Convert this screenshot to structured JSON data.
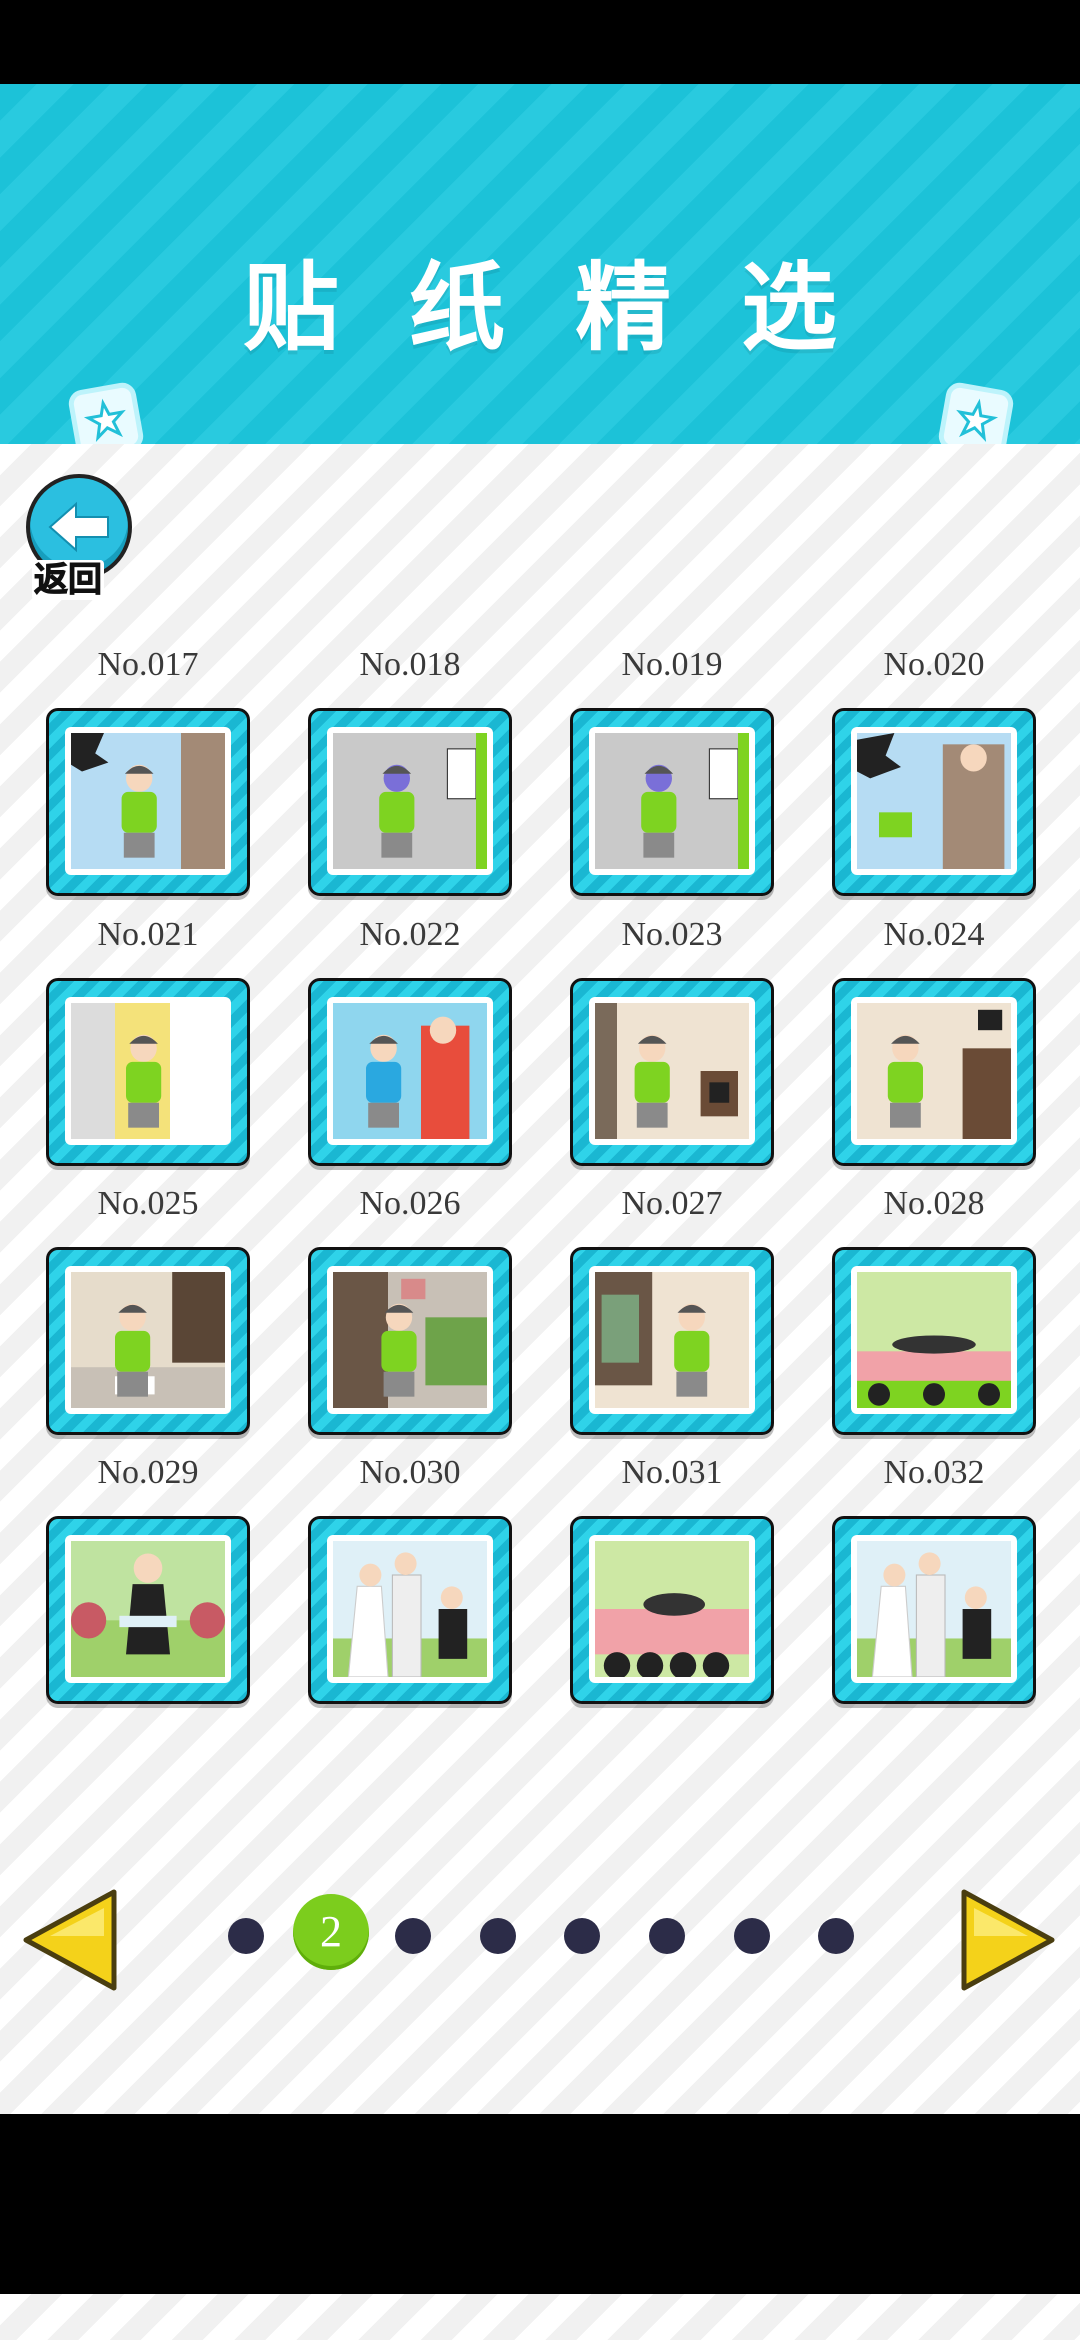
{
  "header": {
    "title": "贴纸精选"
  },
  "back": {
    "label": "返回"
  },
  "stickers": [
    {
      "number": "No.017",
      "scene": "wall-hole-boy",
      "bg": "#b6dcf3"
    },
    {
      "number": "No.018",
      "scene": "boy-purple-face",
      "bg": "#c9c9c9"
    },
    {
      "number": "No.019",
      "scene": "boy-purple-face",
      "bg": "#c9c9c9"
    },
    {
      "number": "No.020",
      "scene": "wall-hole-elder",
      "bg": "#b6dcf3"
    },
    {
      "number": "No.021",
      "scene": "door-visitor",
      "bg": "#f4e27a"
    },
    {
      "number": "No.022",
      "scene": "family-window",
      "bg": "#8fd6ee"
    },
    {
      "number": "No.023",
      "scene": "phone-call",
      "bg": "#efe3d2"
    },
    {
      "number": "No.024",
      "scene": "phone-kneel",
      "bg": "#efe3d2"
    },
    {
      "number": "No.025",
      "scene": "reading-floor",
      "bg": "#e6dccb"
    },
    {
      "number": "No.026",
      "scene": "cabinet",
      "bg": "#c8c0b6"
    },
    {
      "number": "No.027",
      "scene": "phone-music",
      "bg": "#efe3d2"
    },
    {
      "number": "No.028",
      "scene": "wedding-lying",
      "bg": "#cde8a4"
    },
    {
      "number": "No.029",
      "scene": "wedding-boy",
      "bg": "#bfe3a0"
    },
    {
      "number": "No.030",
      "scene": "wedding-couple",
      "bg": "#dff0f7"
    },
    {
      "number": "No.031",
      "scene": "wedding-carpet",
      "bg": "#cde8a4"
    },
    {
      "number": "No.032",
      "scene": "wedding-couple",
      "bg": "#dff0f7"
    }
  ],
  "pager": {
    "current": "2",
    "total": 8
  },
  "colors": {
    "header": "#1cc2d8",
    "active_dot": "#7ccd1d",
    "dot": "#2c2c48",
    "arrow": "#f4d21a"
  }
}
